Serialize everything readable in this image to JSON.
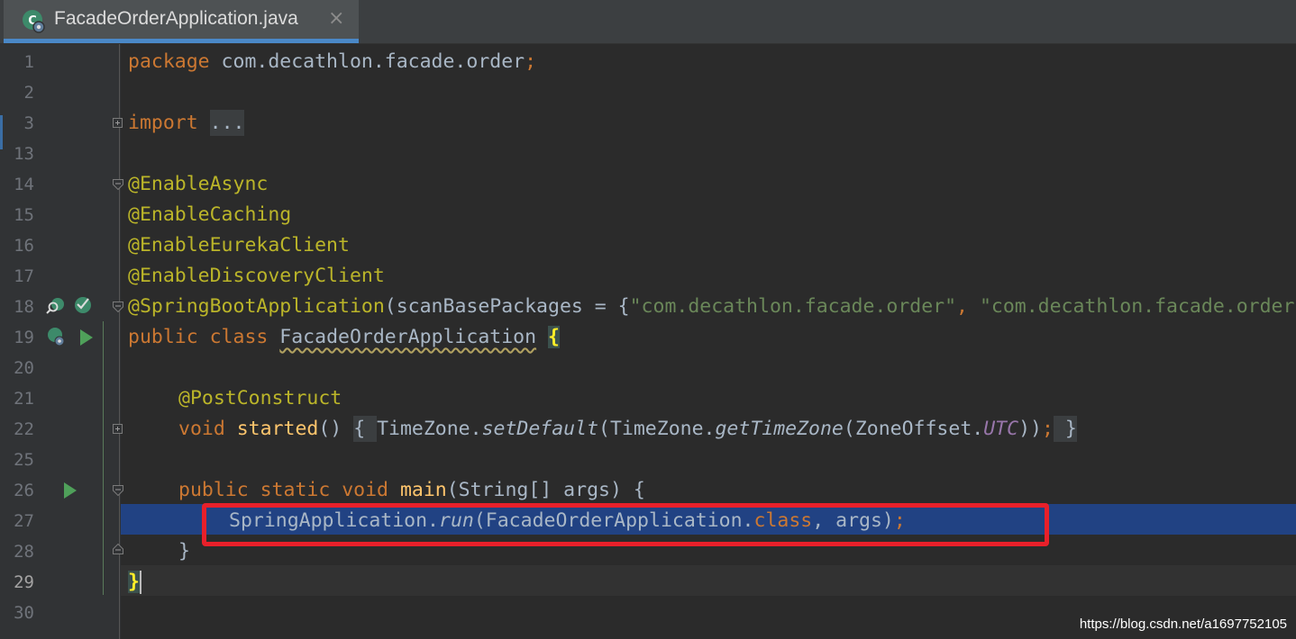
{
  "tab": {
    "title": "FacadeOrderApplication.java",
    "close": "×",
    "icon": "spring-boot-class-icon"
  },
  "gutter": {
    "line_numbers": [
      "1",
      "2",
      "3",
      "13",
      "14",
      "15",
      "16",
      "17",
      "18",
      "19",
      "20",
      "21",
      "22",
      "25",
      "26",
      "27",
      "28",
      "29",
      "30"
    ],
    "current_line": "29"
  },
  "code": {
    "l1_kw": "package",
    "l1_rest": " com.decathlon.facade.order",
    "l1_semi": ";",
    "l3_kw": "import",
    "l3_fold": "...",
    "l14": "@EnableAsync",
    "l15": "@EnableCaching",
    "l16": "@EnableEurekaClient",
    "l17": "@EnableDiscoveryClient",
    "l18_ann": "@SpringBootApplication",
    "l18_open": "(scanBasePackages = {",
    "l18_str1": "\"com.decathlon.facade.order\"",
    "l18_comma": ", ",
    "l18_str2": "\"com.decathlon.facade.order",
    "l19_kw": "public class",
    "l19_name": "FacadeOrderApplication",
    "l19_brace": "{",
    "l21": "@PostConstruct",
    "l22_kw": "void",
    "l22_fn": "started",
    "l22_parens": "() ",
    "l22_fold_open": "{ ",
    "l22_a": "TimeZone.",
    "l22_b": "setDefault",
    "l22_c": "(TimeZone.",
    "l22_d": "getTimeZone",
    "l22_e": "(ZoneOffset.",
    "l22_f": "UTC",
    "l22_g": "))",
    "l22_semi": ";",
    "l22_fold_close": " }",
    "l26_kw": "public static void",
    "l26_fn": "main",
    "l26_rest": "(String[] args) {",
    "l27_a": "SpringApplication.",
    "l27_b": "run",
    "l27_c": "(FacadeOrderApplication.",
    "l27_d": "class",
    "l27_e": ", args)",
    "l27_semi": ";",
    "l28": "}",
    "l29": "}"
  },
  "watermark": "https://blog.csdn.net/a1697752105",
  "colors": {
    "keyword": "#cc7832",
    "annotation": "#bbb529",
    "string": "#6a8759",
    "method": "#ffc66d",
    "highlight_box": "#e8202a",
    "selection": "#214283"
  }
}
